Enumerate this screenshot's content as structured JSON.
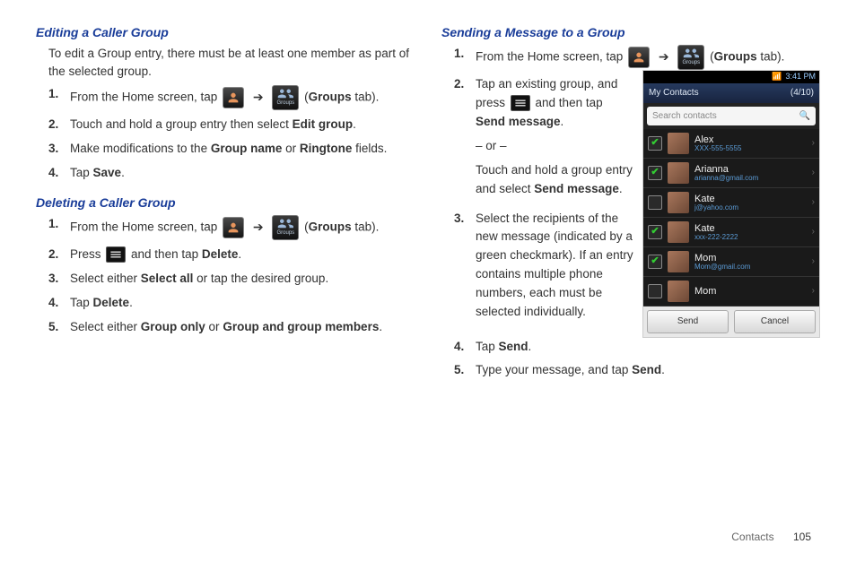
{
  "col1": {
    "editing": {
      "heading": "Editing a Caller Group",
      "intro": "To edit a Group entry, there must be at least one member as part of the selected group.",
      "steps": [
        {
          "num": "1.",
          "pre": "From the Home screen, tap ",
          "hasIcons": true,
          "tabPre": "(",
          "tabBold": "Groups",
          "tabPost": " tab)."
        },
        {
          "num": "2.",
          "parts": [
            "Touch and hold a group entry then select ",
            {
              "b": "Edit group"
            },
            "."
          ]
        },
        {
          "num": "3.",
          "parts": [
            "Make modifications to the ",
            {
              "b": "Group name"
            },
            " or ",
            {
              "b": "Ringtone"
            },
            " fields."
          ]
        },
        {
          "num": "4.",
          "parts": [
            "Tap ",
            {
              "b": "Save"
            },
            "."
          ]
        }
      ]
    },
    "deleting": {
      "heading": "Deleting a Caller Group",
      "steps": [
        {
          "num": "1.",
          "pre": "From the Home screen, tap ",
          "hasIcons": true,
          "tabPre": "(",
          "tabBold": "Groups",
          "tabPost": " tab)."
        },
        {
          "num": "2.",
          "parts": [
            "Press "
          ],
          "midIcon": "menu",
          "parts2": [
            " and then tap ",
            {
              "b": "Delete"
            },
            "."
          ]
        },
        {
          "num": "3.",
          "parts": [
            "Select either ",
            {
              "b": "Select all"
            },
            " or tap the desired group."
          ]
        },
        {
          "num": "4.",
          "parts": [
            "Tap ",
            {
              "b": "Delete"
            },
            "."
          ]
        },
        {
          "num": "5.",
          "parts": [
            "Select either ",
            {
              "b": "Group only"
            },
            " or ",
            {
              "b": "Group and group members"
            },
            "."
          ]
        }
      ]
    }
  },
  "col2": {
    "sending": {
      "heading": "Sending a Message to a Group",
      "step1": {
        "num": "1.",
        "pre": "From the Home screen, tap ",
        "tabPre": "(",
        "tabBold": "Groups",
        "tabPost": " tab)."
      },
      "step2": {
        "num": "2.",
        "line1a": "Tap an existing group, and press ",
        "line1b": " and then tap ",
        "bold1": "Send message",
        "line1c": ".",
        "or": "– or –",
        "line2a": "Touch and hold a group entry and select ",
        "bold2": "Send message",
        "line2b": "."
      },
      "step3": {
        "num": "3.",
        "text": "Select the recipients of the new message (indicated by a green checkmark). If an entry contains multiple phone numbers, each must be selected individually."
      },
      "step4": {
        "num": "4.",
        "parts": [
          "Tap ",
          {
            "b": "Send"
          },
          "."
        ]
      },
      "step5": {
        "num": "5.",
        "parts": [
          "Type your message, and tap ",
          {
            "b": "Send"
          },
          "."
        ]
      }
    }
  },
  "phone": {
    "time": "3:41 PM",
    "header_title": "My Contacts",
    "header_count": "(4/10)",
    "search_placeholder": "Search contacts",
    "contacts": [
      {
        "checked": true,
        "name": "Alex",
        "sub": "XXX-555-5555"
      },
      {
        "checked": true,
        "name": "Arianna",
        "sub": "arianna@gmail.com"
      },
      {
        "checked": false,
        "name": "Kate",
        "sub": "j@yahoo.com"
      },
      {
        "checked": true,
        "name": "Kate",
        "sub": "xxx-222-2222"
      },
      {
        "checked": true,
        "name": "Mom",
        "sub": "Mom@gmail.com"
      },
      {
        "checked": false,
        "name": "Mom",
        "sub": ""
      }
    ],
    "btn_send": "Send",
    "btn_cancel": "Cancel"
  },
  "footer": {
    "section": "Contacts",
    "page": "105"
  },
  "icons": {
    "groups_label": "Groups"
  }
}
